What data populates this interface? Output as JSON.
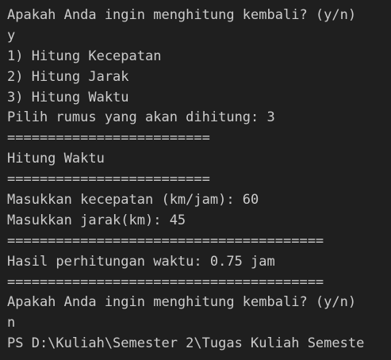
{
  "terminal": {
    "background": "#1f1f1f",
    "foreground": "#cccccc",
    "lines": [
      "Apakah Anda ingin menghitung kembali? (y/n)",
      "y",
      "1) Hitung Kecepatan",
      "2) Hitung Jarak",
      "3) Hitung Waktu",
      "Pilih rumus yang akan dihitung: 3",
      "=========================",
      "Hitung Waktu",
      "=========================",
      "Masukkan kecepatan (km/jam): 60",
      "Masukkan jarak(km): 45",
      "=======================================",
      "Hasil perhitungan waktu: 0.75 jam",
      "=======================================",
      "Apakah Anda ingin menghitung kembali? (y/n)",
      "n",
      "PS D:\\Kuliah\\Semester 2\\Tugas Kuliah Semeste"
    ]
  }
}
